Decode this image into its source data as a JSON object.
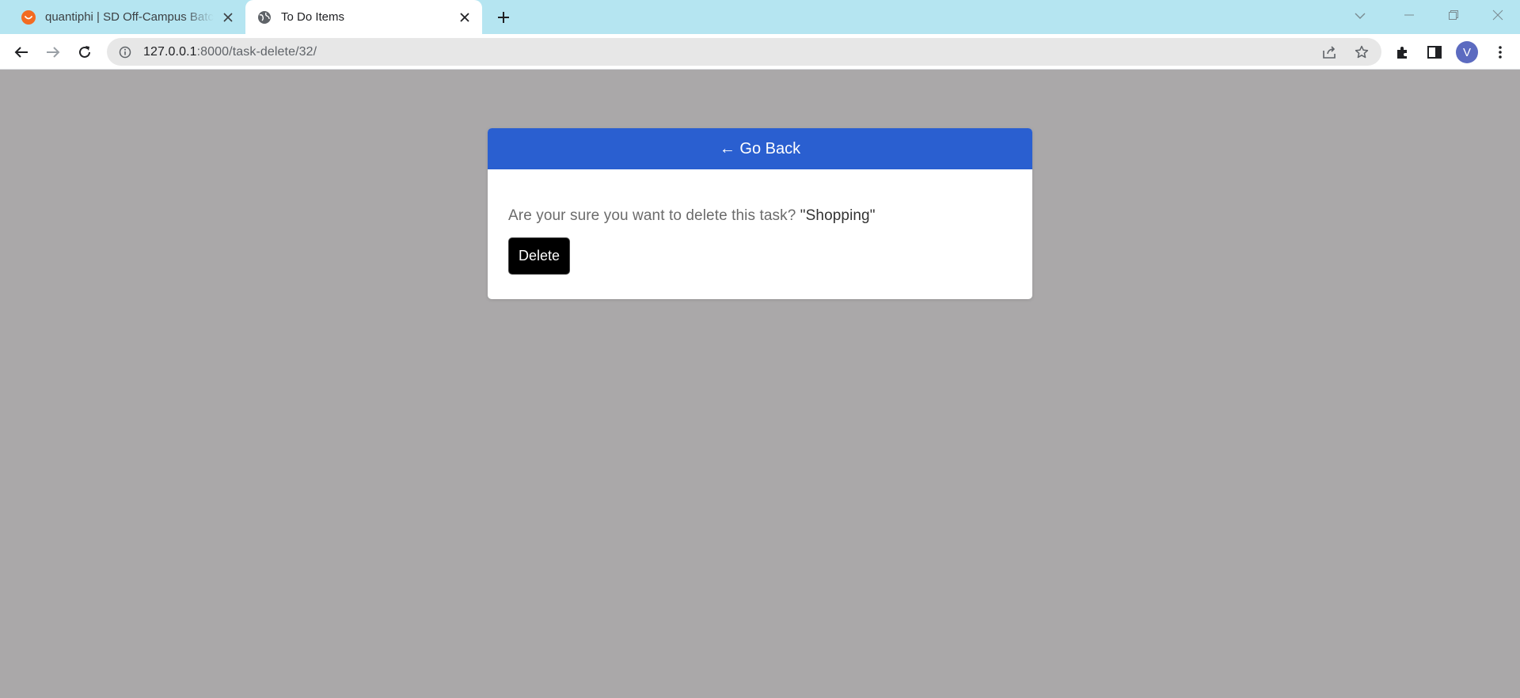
{
  "browser": {
    "tabs": [
      {
        "title": "quantiphi | SD Off-Campus Batch",
        "active": false,
        "favicon": "orange-smile-icon"
      },
      {
        "title": "To Do Items",
        "active": true,
        "favicon": "globe-icon"
      }
    ],
    "url_host": "127.0.0.1",
    "url_path": ":8000/task-delete/32/",
    "profile_initial": "V",
    "profile_color": "#5c6bc0",
    "tabstrip_color": "#b5e5f1"
  },
  "page": {
    "go_back_label": "← Go Back",
    "confirm_text": "Are your sure you want to delete this task?",
    "task_name": "\"Shopping\"",
    "delete_label": "Delete",
    "header_color": "#2a5fd0",
    "background_color": "#aaa8a9"
  }
}
